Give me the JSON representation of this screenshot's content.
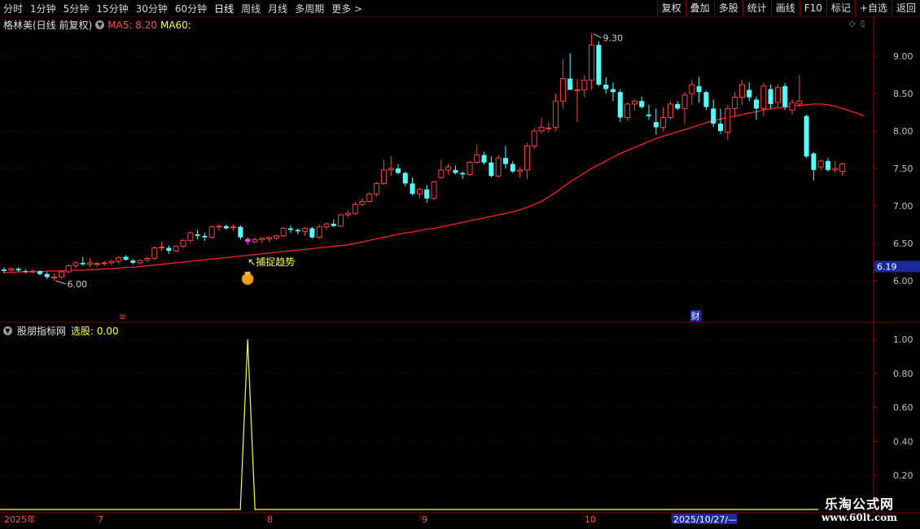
{
  "toolbar": {
    "periods": [
      "分时",
      "1分钟",
      "5分钟",
      "15分钟",
      "30分钟",
      "60分钟",
      "日线",
      "周线",
      "月线",
      "多周期",
      "更多 >"
    ],
    "active_period": "日线",
    "actions": [
      "复权",
      "叠加",
      "多股",
      "统计",
      "画线",
      "F10",
      "标记",
      "+自选",
      "返回"
    ]
  },
  "main_panel": {
    "stock_label": "格林美(日线 前复权)",
    "ma5_label": "MA5: 8.20",
    "ma60_label": "MA60:",
    "colors": {
      "up": "#ff4040",
      "down": "#54ffff",
      "ma60": "#ff2020",
      "signal_bar": "#ff40ff",
      "axis": "#b00000",
      "text_yellow": "#ffff40"
    }
  },
  "indicator_panel": {
    "name": "股朋指标网",
    "value_label": "选股: 0.00"
  },
  "chart_data": [
    {
      "type": "candlestick",
      "title": "格林美(日线 前复权)",
      "ylim": [
        5.6,
        9.5
      ],
      "y_ticks": [
        "9.00",
        "8.50",
        "8.00",
        "7.50",
        "7.00",
        "6.50",
        "6.00"
      ],
      "current_price_label": "6.19",
      "annotations": {
        "high": "9.30",
        "low": "6.00",
        "signal": "↖捕捉趋势"
      },
      "event_markers": {
        "red": "≋",
        "blue": "财"
      },
      "x_labels": [
        "2025年",
        "7",
        "8",
        "9",
        "10",
        "2025/10/27/—"
      ],
      "ohlc": [
        [
          6.15,
          6.18,
          6.1,
          6.13
        ],
        [
          6.14,
          6.18,
          6.12,
          6.16
        ],
        [
          6.16,
          6.18,
          6.12,
          6.14
        ],
        [
          6.13,
          6.15,
          6.1,
          6.12
        ],
        [
          6.12,
          6.15,
          6.1,
          6.13
        ],
        [
          6.13,
          6.14,
          6.07,
          6.09
        ],
        [
          6.09,
          6.12,
          6.02,
          6.05
        ],
        [
          6.05,
          6.1,
          6.0,
          6.05
        ],
        [
          6.05,
          6.13,
          6.03,
          6.12
        ],
        [
          6.12,
          6.22,
          6.1,
          6.2
        ],
        [
          6.2,
          6.26,
          6.16,
          6.24
        ],
        [
          6.24,
          6.32,
          6.2,
          6.22
        ],
        [
          6.22,
          6.3,
          6.18,
          6.24
        ],
        [
          6.22,
          6.25,
          6.18,
          6.23
        ],
        [
          6.23,
          6.27,
          6.2,
          6.24
        ],
        [
          6.24,
          6.28,
          6.2,
          6.26
        ],
        [
          6.26,
          6.33,
          6.23,
          6.31
        ],
        [
          6.32,
          6.34,
          6.27,
          6.28
        ],
        [
          6.27,
          6.29,
          6.22,
          6.24
        ],
        [
          6.24,
          6.29,
          6.22,
          6.27
        ],
        [
          6.28,
          6.32,
          6.25,
          6.3
        ],
        [
          6.3,
          6.46,
          6.28,
          6.44
        ],
        [
          6.44,
          6.52,
          6.4,
          6.45
        ],
        [
          6.44,
          6.47,
          6.36,
          6.4
        ],
        [
          6.4,
          6.48,
          6.38,
          6.46
        ],
        [
          6.46,
          6.56,
          6.43,
          6.54
        ],
        [
          6.54,
          6.66,
          6.5,
          6.64
        ],
        [
          6.62,
          6.68,
          6.55,
          6.6
        ],
        [
          6.6,
          6.64,
          6.53,
          6.58
        ],
        [
          6.58,
          6.74,
          6.56,
          6.72
        ],
        [
          6.72,
          6.76,
          6.66,
          6.73
        ],
        [
          6.73,
          6.75,
          6.68,
          6.7
        ],
        [
          6.71,
          6.75,
          6.66,
          6.72
        ],
        [
          6.72,
          6.74,
          6.55,
          6.58
        ],
        [
          6.56,
          6.58,
          6.48,
          6.52
        ],
        [
          6.52,
          6.58,
          6.5,
          6.55
        ],
        [
          6.55,
          6.58,
          6.5,
          6.57
        ],
        [
          6.56,
          6.59,
          6.52,
          6.58
        ],
        [
          6.57,
          6.61,
          6.54,
          6.6
        ],
        [
          6.6,
          6.72,
          6.58,
          6.7
        ],
        [
          6.7,
          6.74,
          6.64,
          6.68
        ],
        [
          6.68,
          6.7,
          6.62,
          6.66
        ],
        [
          6.66,
          6.72,
          6.6,
          6.7
        ],
        [
          6.7,
          6.72,
          6.56,
          6.58
        ],
        [
          6.58,
          6.75,
          6.56,
          6.72
        ],
        [
          6.72,
          6.78,
          6.68,
          6.76
        ],
        [
          6.76,
          6.82,
          6.72,
          6.73
        ],
        [
          6.73,
          6.9,
          6.72,
          6.88
        ],
        [
          6.88,
          6.95,
          6.85,
          6.9
        ],
        [
          6.9,
          7.05,
          6.88,
          7.02
        ],
        [
          7.02,
          7.1,
          7.0,
          7.06
        ],
        [
          7.06,
          7.18,
          7.04,
          7.16
        ],
        [
          7.16,
          7.32,
          7.12,
          7.3
        ],
        [
          7.3,
          7.62,
          7.28,
          7.48
        ],
        [
          7.48,
          7.66,
          7.4,
          7.5
        ],
        [
          7.5,
          7.56,
          7.42,
          7.44
        ],
        [
          7.44,
          7.46,
          7.26,
          7.3
        ],
        [
          7.3,
          7.38,
          7.14,
          7.16
        ],
        [
          7.16,
          7.24,
          7.1,
          7.22
        ],
        [
          7.22,
          7.28,
          7.04,
          7.1
        ],
        [
          7.1,
          7.34,
          7.08,
          7.32
        ],
        [
          7.38,
          7.62,
          7.36,
          7.48
        ],
        [
          7.48,
          7.56,
          7.42,
          7.52
        ],
        [
          7.48,
          7.54,
          7.42,
          7.44
        ],
        [
          7.44,
          7.46,
          7.36,
          7.42
        ],
        [
          7.42,
          7.6,
          7.4,
          7.58
        ],
        [
          7.58,
          7.82,
          7.56,
          7.68
        ],
        [
          7.68,
          7.72,
          7.55,
          7.58
        ],
        [
          7.58,
          7.66,
          7.38,
          7.4
        ],
        [
          7.4,
          7.68,
          7.38,
          7.64
        ],
        [
          7.64,
          7.8,
          7.5,
          7.56
        ],
        [
          7.56,
          7.6,
          7.44,
          7.46
        ],
        [
          7.46,
          7.52,
          7.38,
          7.48
        ],
        [
          7.48,
          7.84,
          7.36,
          7.8
        ],
        [
          7.8,
          8.04,
          7.76,
          8.0
        ],
        [
          8.0,
          8.18,
          7.96,
          8.05
        ],
        [
          8.04,
          8.12,
          7.98,
          8.04
        ],
        [
          8.05,
          8.5,
          8.0,
          8.4
        ],
        [
          8.4,
          8.96,
          8.3,
          8.7
        ],
        [
          8.7,
          9.04,
          8.6,
          8.55
        ],
        [
          8.55,
          8.7,
          8.12,
          8.55
        ],
        [
          8.55,
          8.75,
          8.45,
          8.68
        ],
        [
          8.68,
          9.3,
          8.55,
          9.15
        ],
        [
          9.15,
          9.2,
          8.6,
          8.62
        ],
        [
          8.62,
          8.72,
          8.5,
          8.56
        ],
        [
          8.56,
          8.65,
          8.4,
          8.52
        ],
        [
          8.52,
          8.56,
          8.12,
          8.18
        ],
        [
          8.18,
          8.38,
          8.14,
          8.36
        ],
        [
          8.36,
          8.42,
          8.28,
          8.4
        ],
        [
          8.4,
          8.46,
          8.3,
          8.32
        ],
        [
          8.22,
          8.35,
          8.15,
          8.2
        ],
        [
          8.12,
          8.3,
          7.95,
          8.05
        ],
        [
          8.05,
          8.32,
          8.0,
          8.18
        ],
        [
          8.18,
          8.4,
          8.15,
          8.36
        ],
        [
          8.36,
          8.4,
          8.28,
          8.3
        ],
        [
          8.3,
          8.52,
          8.1,
          8.48
        ],
        [
          8.5,
          8.68,
          8.35,
          8.62
        ],
        [
          8.6,
          8.72,
          8.38,
          8.52
        ],
        [
          8.52,
          8.54,
          8.28,
          8.32
        ],
        [
          8.3,
          8.42,
          8.05,
          8.1
        ],
        [
          8.1,
          8.3,
          7.96,
          8.0
        ],
        [
          7.98,
          8.35,
          7.88,
          8.3
        ],
        [
          8.3,
          8.52,
          8.18,
          8.45
        ],
        [
          8.45,
          8.68,
          8.35,
          8.62
        ],
        [
          8.55,
          8.65,
          8.4,
          8.45
        ],
        [
          8.42,
          8.46,
          8.15,
          8.3
        ],
        [
          8.3,
          8.65,
          8.2,
          8.6
        ],
        [
          8.56,
          8.62,
          8.3,
          8.36
        ],
        [
          8.38,
          8.62,
          8.32,
          8.58
        ],
        [
          8.6,
          8.64,
          8.28,
          8.32
        ],
        [
          8.28,
          8.42,
          8.22,
          8.38
        ],
        [
          8.36,
          8.75,
          8.32,
          8.4
        ],
        [
          8.2,
          8.22,
          7.64,
          7.66
        ],
        [
          7.7,
          7.72,
          7.34,
          7.48
        ],
        [
          7.52,
          7.62,
          7.48,
          7.6
        ],
        [
          7.6,
          7.64,
          7.46,
          7.48
        ],
        [
          7.48,
          7.6,
          7.44,
          7.5
        ],
        [
          7.46,
          7.58,
          7.4,
          7.56
        ]
      ],
      "ma60": [
        6.11,
        6.11,
        6.12,
        6.12,
        6.12,
        6.12,
        6.13,
        6.13,
        6.13,
        6.14,
        6.14,
        6.14,
        6.15,
        6.15,
        6.16,
        6.16,
        6.17,
        6.18,
        6.18,
        6.19,
        6.2,
        6.21,
        6.22,
        6.23,
        6.24,
        6.25,
        6.26,
        6.27,
        6.28,
        6.29,
        6.3,
        6.31,
        6.32,
        6.33,
        6.34,
        6.35,
        6.36,
        6.37,
        6.38,
        6.39,
        6.4,
        6.41,
        6.42,
        6.43,
        6.44,
        6.45,
        6.46,
        6.47,
        6.48,
        6.5,
        6.52,
        6.54,
        6.56,
        6.58,
        6.6,
        6.62,
        6.64,
        6.65,
        6.67,
        6.69,
        6.7,
        6.72,
        6.74,
        6.76,
        6.78,
        6.8,
        6.82,
        6.84,
        6.86,
        6.88,
        6.9,
        6.92,
        6.95,
        6.98,
        7.02,
        7.06,
        7.12,
        7.18,
        7.25,
        7.32,
        7.38,
        7.44,
        7.5,
        7.55,
        7.6,
        7.65,
        7.7,
        7.74,
        7.78,
        7.82,
        7.86,
        7.9,
        7.93,
        7.96,
        7.99,
        8.02,
        8.05,
        8.08,
        8.11,
        8.14,
        8.16,
        8.18,
        8.2,
        8.22,
        8.24,
        8.26,
        8.28,
        8.3,
        8.31,
        8.32,
        8.33,
        8.34,
        8.35,
        8.36,
        8.36,
        8.35,
        8.33,
        8.3,
        8.27,
        8.24,
        8.2
      ]
    },
    {
      "type": "line",
      "title": "股朋指标网",
      "series": [
        {
          "name": "选股",
          "values": "0 everywhere except 1.00 at bar 34"
        }
      ],
      "signal_bar_index": 34,
      "ylim": [
        0,
        1.05
      ],
      "y_ticks": [
        "1.00",
        "0.80",
        "0.60",
        "0.40",
        "0.20"
      ]
    }
  ]
}
